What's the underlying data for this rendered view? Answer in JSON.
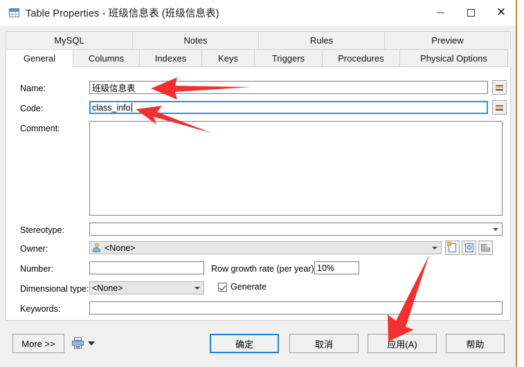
{
  "window": {
    "title": "Table Properties - 班级信息表 (班级信息表)",
    "icon": "table-icon",
    "controls": {
      "minimize": "—",
      "maximize": "▢",
      "close": "✕"
    }
  },
  "tabs": {
    "row1": [
      {
        "label": "MySQL",
        "active": false
      },
      {
        "label": "Notes",
        "active": false
      },
      {
        "label": "Rules",
        "active": false
      },
      {
        "label": "Preview",
        "active": false
      }
    ],
    "row2": [
      {
        "label": "General",
        "active": true
      },
      {
        "label": "Columns",
        "active": false
      },
      {
        "label": "Indexes",
        "active": false
      },
      {
        "label": "Keys",
        "active": false
      },
      {
        "label": "Triggers",
        "active": false
      },
      {
        "label": "Procedures",
        "active": false
      },
      {
        "label": "Physical Options",
        "active": false
      }
    ]
  },
  "form": {
    "name": {
      "label": "Name:",
      "value": "班级信息表",
      "placeholder": ""
    },
    "code": {
      "label": "Code:",
      "value": "class_info",
      "placeholder": ""
    },
    "comment": {
      "label": "Comment:",
      "value": "",
      "placeholder": ""
    },
    "stereotype": {
      "label": "Stereotype:",
      "value": "",
      "placeholder": ""
    },
    "owner": {
      "label": "Owner:",
      "value": "<None>",
      "icon": "user-icon"
    },
    "number": {
      "label": "Number:",
      "value": "",
      "placeholder": ""
    },
    "row_growth": {
      "label": "Row growth rate (per year):",
      "value": "10%"
    },
    "dimensional_type": {
      "label": "Dimensional type:",
      "value": "<None>"
    },
    "generate": {
      "label": "Generate",
      "checked": true
    },
    "keywords": {
      "label": "Keywords:",
      "value": "",
      "placeholder": ""
    },
    "equals_button_glyph": "≡"
  },
  "buttons": {
    "more": "More >>",
    "ok": "确定",
    "cancel": "取消",
    "apply": "应用(A)",
    "help": "帮助"
  },
  "annotations": {
    "accent_color": "#f23030",
    "arrow_targets": [
      "name-field",
      "code-field",
      "apply-button"
    ]
  },
  "colors": {
    "focus_blue": "#2a8fe0",
    "dialog_bg": "#f0f0f0",
    "page_bg": "#ffffff",
    "edge_accent": "#c8853c"
  }
}
